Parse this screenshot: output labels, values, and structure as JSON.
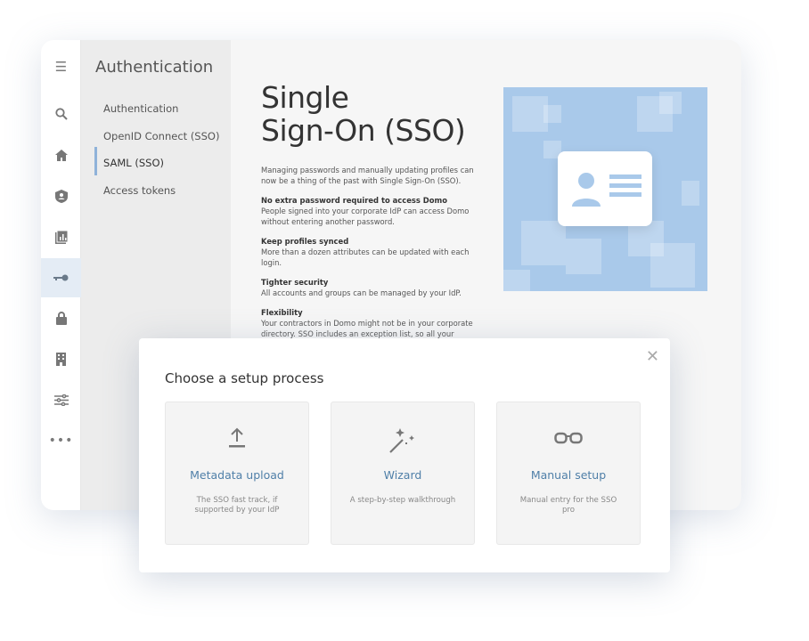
{
  "rail": {
    "icons": [
      "menu-icon",
      "search-icon",
      "home-icon",
      "user-shield-icon",
      "report-icon",
      "key-icon",
      "lock-icon",
      "building-icon",
      "sliders-icon",
      "more-icon"
    ],
    "active": "key-icon"
  },
  "sidebar": {
    "title": "Authentication",
    "items": [
      {
        "label": "Authentication"
      },
      {
        "label": "OpenID Connect (SSO)"
      },
      {
        "label": "SAML (SSO)",
        "active": true
      },
      {
        "label": "Access tokens"
      }
    ]
  },
  "main": {
    "title_line1": "Single",
    "title_line2": "Sign-On (SSO)",
    "intro": "Managing passwords and manually updating profiles can now be a thing of the past with Single Sign-On (SSO).",
    "features": [
      {
        "heading": "No extra password required to access Domo",
        "text": "People signed into your corporate IdP can access Domo without entering another password."
      },
      {
        "heading": "Keep profiles synced",
        "text": "More than a dozen attributes can be updated with each login."
      },
      {
        "heading": "Tighter security",
        "text": "All accounts and groups can be managed by your IdP."
      },
      {
        "heading": "Flexibility",
        "text": "Your contractors in Domo might not be in your corporate directory. SSO includes an exception list, so all your people"
      }
    ],
    "illustration_color": "#a9c9ea"
  },
  "modal": {
    "title": "Choose a setup process",
    "options": [
      {
        "icon": "upload-icon",
        "label": "Metadata upload",
        "desc": "The SSO fast track, if supported by your IdP"
      },
      {
        "icon": "magic-wand-icon",
        "label": "Wizard",
        "desc": "A step-by-step walkthrough"
      },
      {
        "icon": "glasses-icon",
        "label": "Manual setup",
        "desc": "Manual entry for the SSO pro"
      }
    ]
  },
  "colors": {
    "accent": "#4f7fa8",
    "active_bar": "#8fb2d9"
  }
}
